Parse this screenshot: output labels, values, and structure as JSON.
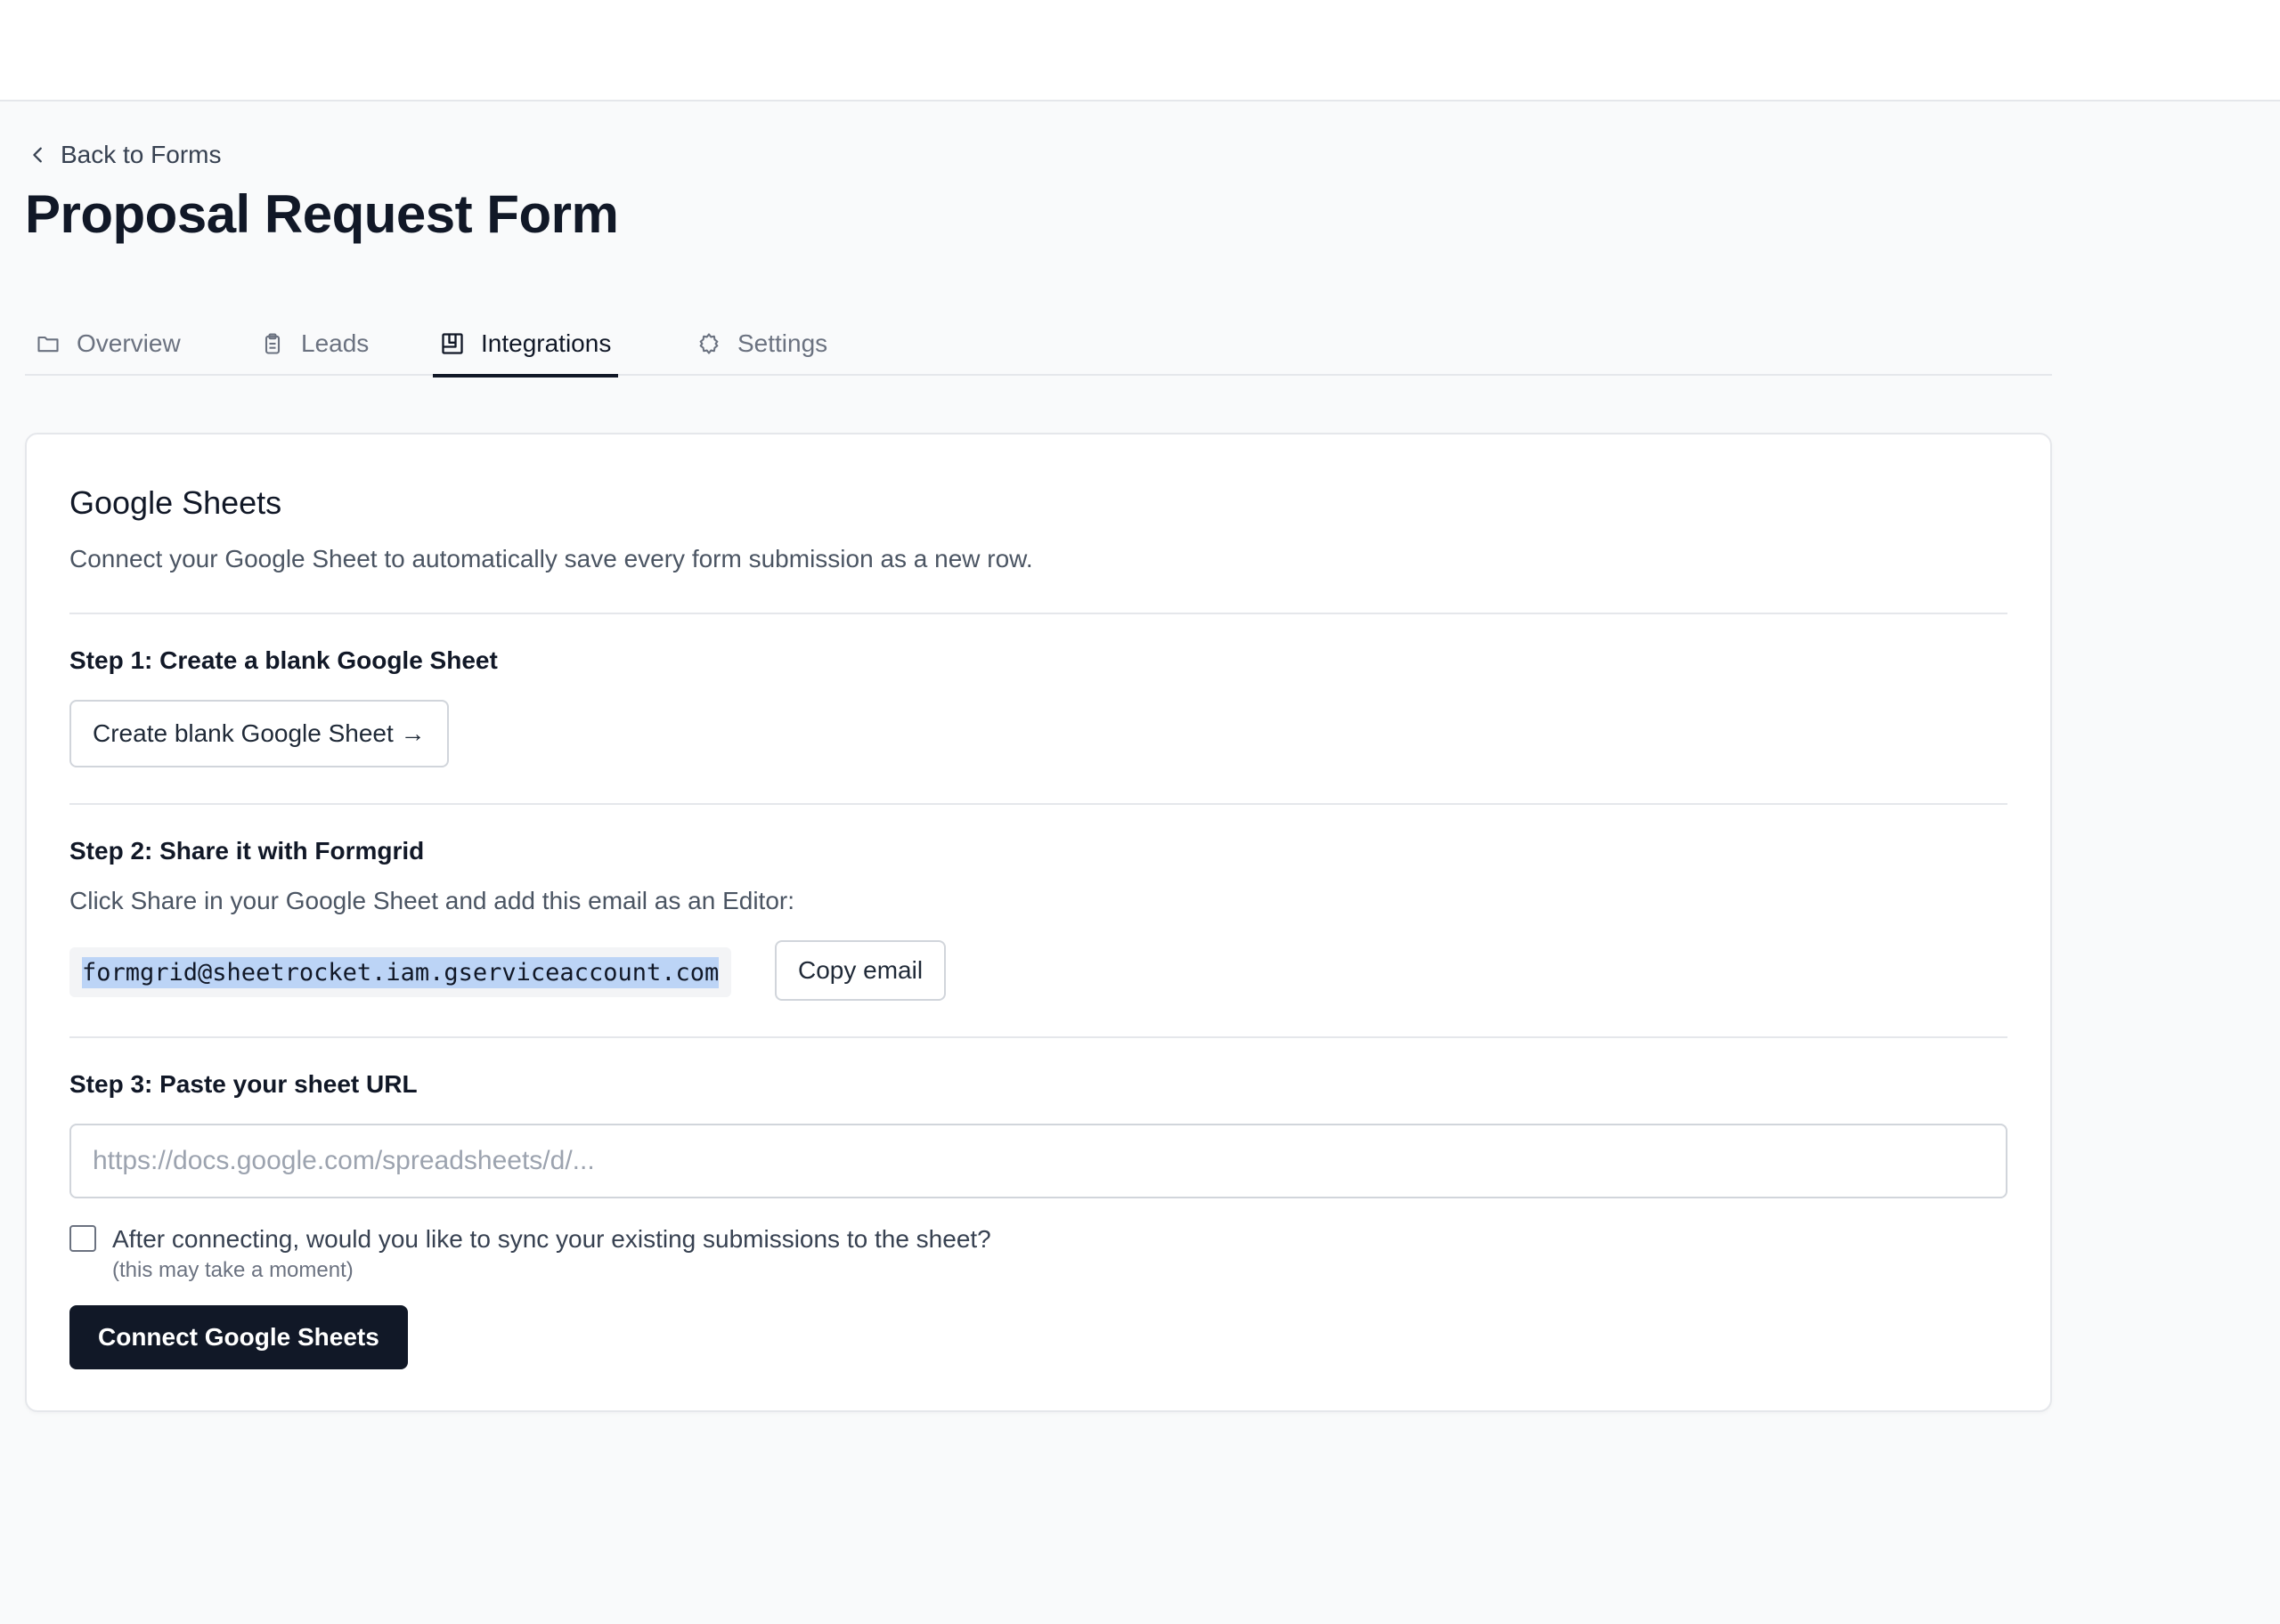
{
  "nav": {
    "back_label": "Back to Forms"
  },
  "page": {
    "title": "Proposal Request Form"
  },
  "tabs": [
    {
      "label": "Overview",
      "icon": "folder-icon",
      "active": false
    },
    {
      "label": "Leads",
      "icon": "clipboard-icon",
      "active": false
    },
    {
      "label": "Integrations",
      "icon": "integrations-icon",
      "active": true
    },
    {
      "label": "Settings",
      "icon": "gear-icon",
      "active": false
    }
  ],
  "card": {
    "title": "Google Sheets",
    "description": "Connect your Google Sheet to automatically save every form submission as a new row.",
    "step1": {
      "title": "Step 1: Create a blank Google Sheet",
      "button_label": "Create blank Google Sheet →"
    },
    "step2": {
      "title": "Step 2: Share it with Formgrid",
      "text": "Click Share in your Google Sheet and add this email as an Editor:",
      "email": "formgrid@sheetrocket.iam.gserviceaccount.com",
      "copy_label": "Copy email"
    },
    "step3": {
      "title": "Step 3: Paste your sheet URL",
      "url_placeholder": "https://docs.google.com/spreadsheets/d/...",
      "url_value": "",
      "sync_label": "After connecting, would you like to sync your existing submissions to the sheet?",
      "sync_note": "(this may take a moment)",
      "sync_checked": false,
      "connect_label": "Connect Google Sheets"
    }
  },
  "colors": {
    "primary": "#111827",
    "muted_text": "#6b7280",
    "border": "#e5e7eb",
    "highlight": "#bcd4f6",
    "background": "#f9fafb"
  }
}
